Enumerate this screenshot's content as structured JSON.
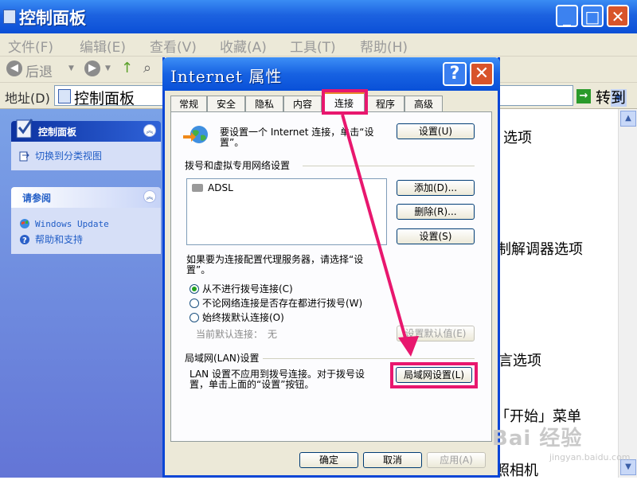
{
  "window": {
    "title": "控制面板",
    "address_label": "地址(D)",
    "address_value": "控制面板",
    "go_label": "转到",
    "back_label": "后退"
  },
  "menu": [
    "文件(F)",
    "编辑(E)",
    "查看(V)",
    "收藏(A)",
    "工具(T)",
    "帮助(H)"
  ],
  "sidebar": {
    "panel1_title": "控制面板",
    "panel1_item": "切换到分类视图",
    "panel2_title": "请参阅",
    "panel2_items": [
      "Windows Update",
      "帮助和支持"
    ]
  },
  "right_pane_texts": [
    "选项",
    "制解调器选项",
    "言选项",
    "「开始」菜单",
    "照相机"
  ],
  "dialog": {
    "title": "Internet 属性",
    "tabs": [
      "常规",
      "安全",
      "隐私",
      "内容",
      "连接",
      "程序",
      "高级"
    ],
    "active_tab": "连接",
    "setup_text_line1": "要设置一个 Internet 连接，单击“设",
    "setup_text_line2": "置”。",
    "setup_button": "设置(U)",
    "dialup_group_label": "拨号和虚拟专用网络设置",
    "connections": [
      "ADSL"
    ],
    "add_button": "添加(D)...",
    "remove_button": "删除(R)...",
    "settings_button": "设置(S)",
    "proxy_text_line1": "如果要为连接配置代理服务器，请选择“设",
    "proxy_text_line2": "置”。",
    "radio_never": "从不进行拨号连接(C)",
    "radio_no_network": "不论网络连接是否存在都进行拨号(W)",
    "radio_always": "始终拨默认连接(O)",
    "radio_selected": "从不进行拨号连接(C)",
    "current_default": "当前默认连接：",
    "current_default_value": "无",
    "set_default_button": "设置默认值(E)",
    "lan_group_label": "局域网(LAN)设置",
    "lan_text_line1": "LAN 设置不应用到拨号连接。对于拨号设",
    "lan_text_line2": "置，单击上面的“设置”按钮。",
    "lan_button": "局域网设置(L)",
    "ok_button": "确定",
    "cancel_button": "取消",
    "apply_button": "应用(A)"
  },
  "annotation_color": "#e8176e",
  "watermark": "Bai 经验",
  "watermark_sub": "jingyan.baidu.com"
}
